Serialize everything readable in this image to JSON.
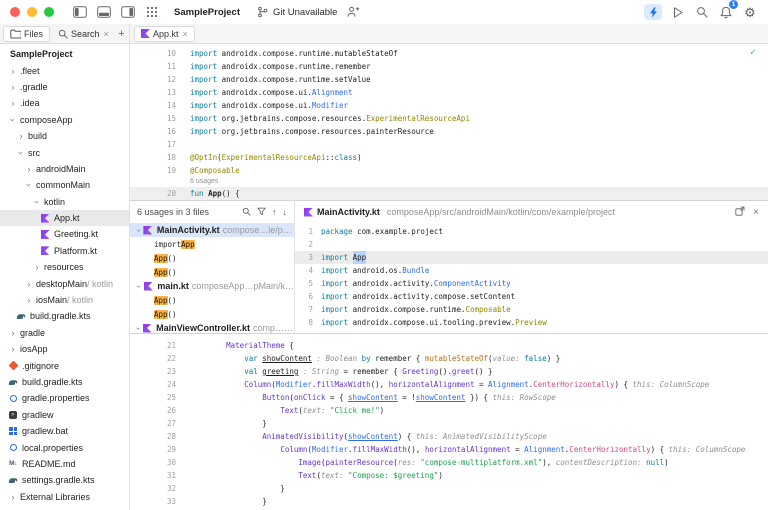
{
  "toolbar": {
    "project": "SampleProject",
    "git_status": "Git Unavailable",
    "notification_count": "1"
  },
  "tabs": {
    "files_label": "Files",
    "search_label": "Search",
    "editor_tab": "App.kt"
  },
  "colors": {
    "accent": "#2e7df6",
    "usage_highlight": "#f6b14a",
    "selection": "#b6d6fc",
    "kotlin_brand": "#7f52ff"
  },
  "sidebar": {
    "tree": [
      {
        "label": "SampleProject",
        "indent": 0,
        "header": true
      },
      {
        "label": ".fleet",
        "indent": 0,
        "chev": "closed"
      },
      {
        "label": ".gradle",
        "indent": 0,
        "chev": "closed"
      },
      {
        "label": ".idea",
        "indent": 0,
        "chev": "closed"
      },
      {
        "label": "composeApp",
        "indent": 0,
        "chev": "open"
      },
      {
        "label": "build",
        "indent": 1,
        "chev": "closed"
      },
      {
        "label": "src",
        "indent": 1,
        "chev": "open"
      },
      {
        "label": "androidMain",
        "indent": 2,
        "chev": "closed"
      },
      {
        "label": "commonMain",
        "indent": 2,
        "chev": "open"
      },
      {
        "label": "kotlin",
        "indent": 3,
        "chev": "open"
      },
      {
        "label": "App.kt",
        "indent": 4,
        "icon": "kotlin",
        "selected": true
      },
      {
        "label": "Greeting.kt",
        "indent": 4,
        "icon": "kotlin"
      },
      {
        "label": "Platform.kt",
        "indent": 4,
        "icon": "kotlin"
      },
      {
        "label": "resources",
        "indent": 3,
        "chev": "closed"
      },
      {
        "label": "desktopMain",
        "suffix": " / kotlin",
        "indent": 2,
        "chev": "closed"
      },
      {
        "label": "iosMain",
        "suffix": " / kotlin",
        "indent": 2,
        "chev": "closed"
      },
      {
        "label": "build.gradle.kts",
        "indent": 1,
        "icon": "gradle"
      },
      {
        "label": "gradle",
        "indent": 0,
        "chev": "closed"
      },
      {
        "label": "iosApp",
        "indent": 0,
        "chev": "closed"
      },
      {
        "label": ".gitignore",
        "indent": 0,
        "icon": "git"
      },
      {
        "label": "build.gradle.kts",
        "indent": 0,
        "icon": "gradle"
      },
      {
        "label": "gradle.properties",
        "indent": 0,
        "icon": "prop"
      },
      {
        "label": "gradlew",
        "indent": 0,
        "icon": "sh"
      },
      {
        "label": "gradlew.bat",
        "indent": 0,
        "icon": "bat"
      },
      {
        "label": "local.properties",
        "indent": 0,
        "icon": "prop"
      },
      {
        "label": "README.md",
        "indent": 0,
        "icon": "md"
      },
      {
        "label": "settings.gradle.kts",
        "indent": 0,
        "icon": "gradle"
      },
      {
        "label": "External Libraries",
        "indent": 0,
        "chev": "closed"
      }
    ]
  },
  "editor_top": {
    "lines": [
      {
        "n": "10",
        "segs": [
          [
            "import",
            "k"
          ],
          [
            " androidx.compose.runtime.mutableStateOf",
            "p"
          ]
        ]
      },
      {
        "n": "11",
        "segs": [
          [
            "import",
            "k"
          ],
          [
            " androidx.compose.runtime.remember",
            "p"
          ]
        ]
      },
      {
        "n": "12",
        "segs": [
          [
            "import",
            "k"
          ],
          [
            " androidx.compose.runtime.setValue",
            "p"
          ]
        ]
      },
      {
        "n": "13",
        "segs": [
          [
            "import",
            "k"
          ],
          [
            " androidx.compose.ui.",
            "p"
          ],
          [
            "Alignment",
            "cl"
          ]
        ]
      },
      {
        "n": "14",
        "segs": [
          [
            "import",
            "k"
          ],
          [
            " androidx.compose.ui.",
            "p"
          ],
          [
            "Modifier",
            "cl"
          ]
        ]
      },
      {
        "n": "15",
        "segs": [
          [
            "import",
            "k"
          ],
          [
            " org.jetbrains.compose.resources.",
            "p"
          ],
          [
            "ExperimentalResourceApi",
            "an"
          ]
        ]
      },
      {
        "n": "16",
        "segs": [
          [
            "import",
            "k"
          ],
          [
            " org.jetbrains.compose.resources.painterResource",
            "p"
          ]
        ]
      },
      {
        "n": "17",
        "segs": []
      },
      {
        "n": "18",
        "segs": [
          [
            "@OptIn",
            "an"
          ],
          [
            "(",
            "p"
          ],
          [
            "ExperimentalResourceApi",
            "an"
          ],
          [
            "::",
            "p"
          ],
          [
            "class",
            "k"
          ],
          [
            ")",
            "p"
          ]
        ]
      },
      {
        "n": "19",
        "segs": [
          [
            "@Composable",
            "an"
          ]
        ]
      },
      {
        "inlay": "6 usages"
      },
      {
        "n": "20",
        "hl": true,
        "segs": [
          [
            "fun",
            "k"
          ],
          [
            " ",
            "p"
          ],
          [
            "App",
            "b"
          ],
          [
            "() {",
            "p"
          ]
        ]
      }
    ]
  },
  "usages": {
    "header": "6 usages in 3 files",
    "items": [
      {
        "kind": "file",
        "name": "MainActivity.kt",
        "path": "compose…le/project",
        "selected": true
      },
      {
        "kind": "usage",
        "segs": [
          [
            "import ",
            "p"
          ],
          [
            "App",
            "hl"
          ]
        ]
      },
      {
        "kind": "usage",
        "segs": [
          [
            "App",
            "hl"
          ],
          [
            "()",
            "p"
          ]
        ]
      },
      {
        "kind": "usage",
        "segs": [
          [
            "App",
            "hl"
          ],
          [
            "()",
            "p"
          ]
        ]
      },
      {
        "kind": "file",
        "name": "main.kt",
        "path": "composeApp…pMain/kotlin"
      },
      {
        "kind": "usage",
        "segs": [
          [
            "App",
            "hl"
          ],
          [
            "()",
            "p"
          ]
        ]
      },
      {
        "kind": "usage",
        "segs": [
          [
            "App",
            "hl"
          ],
          [
            "()",
            "p"
          ]
        ]
      },
      {
        "kind": "file",
        "name": "MainViewController.kt",
        "path": "comp…kotlin"
      }
    ]
  },
  "preview": {
    "file": "MainActivity.kt",
    "path": "composeApp/src/androidMain/kotlin/com/example/project",
    "lines": [
      {
        "n": "1",
        "segs": [
          [
            "package",
            "k"
          ],
          [
            " com.example.project",
            "p"
          ]
        ]
      },
      {
        "n": "2",
        "segs": []
      },
      {
        "n": "3",
        "selrow": true,
        "segs": [
          [
            "import",
            "k"
          ],
          [
            " ",
            "p"
          ],
          [
            "App",
            "sel"
          ]
        ]
      },
      {
        "n": "4",
        "segs": [
          [
            "import",
            "k"
          ],
          [
            " android.os.",
            "p"
          ],
          [
            "Bundle",
            "cl"
          ]
        ]
      },
      {
        "n": "5",
        "segs": [
          [
            "import",
            "k"
          ],
          [
            " androidx.activity.",
            "p"
          ],
          [
            "ComponentActivity",
            "cl"
          ]
        ]
      },
      {
        "n": "6",
        "segs": [
          [
            "import",
            "k"
          ],
          [
            " androidx.activity.compose.setContent",
            "p"
          ]
        ]
      },
      {
        "n": "7",
        "segs": [
          [
            "import",
            "k"
          ],
          [
            " androidx.compose.runtime.",
            "p"
          ],
          [
            "Composable",
            "an"
          ]
        ]
      },
      {
        "n": "8",
        "segs": [
          [
            "import",
            "k"
          ],
          [
            " androidx.compose.ui.tooling.preview.",
            "p"
          ],
          [
            "Preview",
            "an"
          ]
        ]
      }
    ]
  },
  "editor_bottom": {
    "lines": [
      {
        "n": "21",
        "segs": [
          [
            "        ",
            "p"
          ],
          [
            "MaterialTheme",
            "fn"
          ],
          [
            " {",
            "p"
          ]
        ]
      },
      {
        "n": "22",
        "segs": [
          [
            "            ",
            "p"
          ],
          [
            "var",
            "k"
          ],
          [
            " ",
            "p"
          ],
          [
            "showContent",
            "dc"
          ],
          [
            " ",
            "p"
          ],
          [
            ": Boolean",
            "h"
          ],
          [
            " ",
            "p"
          ],
          [
            "by",
            "k"
          ],
          [
            " remember { ",
            "p"
          ],
          [
            "mutableStateOf",
            "ct"
          ],
          [
            "(",
            "p"
          ],
          [
            "value: ",
            "h"
          ],
          [
            "false",
            "k"
          ],
          [
            ") }",
            "p"
          ]
        ]
      },
      {
        "n": "23",
        "segs": [
          [
            "            ",
            "p"
          ],
          [
            "val",
            "k"
          ],
          [
            " ",
            "p"
          ],
          [
            "greeting",
            "dc"
          ],
          [
            " ",
            "p"
          ],
          [
            ": String",
            "h"
          ],
          [
            " = remember { ",
            "p"
          ],
          [
            "Greeting",
            "fn"
          ],
          [
            "().",
            "p"
          ],
          [
            "greet",
            "fn"
          ],
          [
            "() }",
            "p"
          ]
        ]
      },
      {
        "n": "24",
        "segs": [
          [
            "            ",
            "p"
          ],
          [
            "Column",
            "fn"
          ],
          [
            "(",
            "p"
          ],
          [
            "Modifier",
            "cl"
          ],
          [
            ".",
            "p"
          ],
          [
            "fillMaxWidth",
            "fn"
          ],
          [
            "(), ",
            "p"
          ],
          [
            "horizontalAlignment",
            "na"
          ],
          [
            " = ",
            "p"
          ],
          [
            "Alignment",
            "cl"
          ],
          [
            ".",
            "p"
          ],
          [
            "CenterHorizontally",
            "pr"
          ],
          [
            ") { ",
            "p"
          ],
          [
            "this: ColumnScope",
            "h"
          ]
        ]
      },
      {
        "n": "25",
        "segs": [
          [
            "                ",
            "p"
          ],
          [
            "Button",
            "fn"
          ],
          [
            "(",
            "p"
          ],
          [
            "onClick",
            "na"
          ],
          [
            " = { ",
            "p"
          ],
          [
            "showContent",
            "vr"
          ],
          [
            " = !",
            "p"
          ],
          [
            "showContent",
            "vr"
          ],
          [
            " }) { ",
            "p"
          ],
          [
            "this: RowScope",
            "h"
          ]
        ]
      },
      {
        "n": "26",
        "segs": [
          [
            "                    ",
            "p"
          ],
          [
            "Text",
            "fn"
          ],
          [
            "(",
            "p"
          ],
          [
            "text: ",
            "h"
          ],
          [
            "\"Click me!\"",
            "s"
          ],
          [
            ")",
            "p"
          ]
        ]
      },
      {
        "n": "27",
        "segs": [
          [
            "                }",
            "p"
          ]
        ]
      },
      {
        "n": "28",
        "segs": [
          [
            "                ",
            "p"
          ],
          [
            "AnimatedVisibility",
            "fn"
          ],
          [
            "(",
            "p"
          ],
          [
            "showContent",
            "vr"
          ],
          [
            ") { ",
            "p"
          ],
          [
            "this: AnimatedVisibilityScope",
            "h"
          ]
        ]
      },
      {
        "n": "29",
        "segs": [
          [
            "                    ",
            "p"
          ],
          [
            "Column",
            "fn"
          ],
          [
            "(",
            "p"
          ],
          [
            "Modifier",
            "cl"
          ],
          [
            ".",
            "p"
          ],
          [
            "fillMaxWidth",
            "fn"
          ],
          [
            "(), ",
            "p"
          ],
          [
            "horizontalAlignment",
            "na"
          ],
          [
            " = ",
            "p"
          ],
          [
            "Alignment",
            "cl"
          ],
          [
            ".",
            "p"
          ],
          [
            "CenterHorizontally",
            "pr"
          ],
          [
            ") { ",
            "p"
          ],
          [
            "this: ColumnScope",
            "h"
          ]
        ]
      },
      {
        "n": "30",
        "segs": [
          [
            "                        ",
            "p"
          ],
          [
            "Image",
            "fn"
          ],
          [
            "(",
            "p"
          ],
          [
            "painterResource",
            "fn"
          ],
          [
            "(",
            "p"
          ],
          [
            "res: ",
            "h"
          ],
          [
            "\"compose-multiplatform.xml\"",
            "s"
          ],
          [
            "), ",
            "p"
          ],
          [
            "contentDescription: ",
            "h"
          ],
          [
            "null",
            "k"
          ],
          [
            ")",
            "p"
          ]
        ]
      },
      {
        "n": "31",
        "segs": [
          [
            "                        ",
            "p"
          ],
          [
            "Text",
            "fn"
          ],
          [
            "(",
            "p"
          ],
          [
            "text: ",
            "h"
          ],
          [
            "\"Compose: $greeting\"",
            "s"
          ],
          [
            ")",
            "p"
          ]
        ]
      },
      {
        "n": "32",
        "segs": [
          [
            "                    }",
            "p"
          ]
        ]
      },
      {
        "n": "33",
        "segs": [
          [
            "                }",
            "p"
          ]
        ]
      }
    ]
  }
}
